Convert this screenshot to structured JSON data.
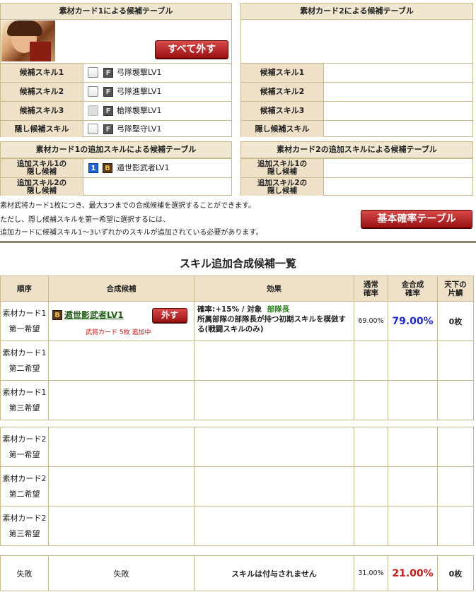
{
  "card1_table": {
    "title": "素材カード1による候補テーブル",
    "remove_all_label": "すべて外す",
    "rows": [
      {
        "label": "候補スキル1",
        "rank": "F",
        "skill": "弓隊襲撃LV1",
        "disabled": false
      },
      {
        "label": "候補スキル2",
        "rank": "F",
        "skill": "弓隊進撃LV1",
        "disabled": false
      },
      {
        "label": "候補スキル3",
        "rank": "F",
        "skill": "槍隊襲撃LV1",
        "disabled": true
      },
      {
        "label": "隠し候補スキル",
        "rank": "F",
        "skill": "弓隊堅守LV1",
        "disabled": false
      }
    ]
  },
  "card2_table": {
    "title": "素材カード2による候補テーブル",
    "rows": [
      {
        "label": "候補スキル1"
      },
      {
        "label": "候補スキル2"
      },
      {
        "label": "候補スキル3"
      },
      {
        "label": "隠し候補スキル"
      }
    ]
  },
  "card1_extra": {
    "title": "素材カード1の追加スキルによる候補テーブル",
    "rows": [
      {
        "label_a": "追加スキル1の",
        "label_b": "隠し候補",
        "num": "1",
        "rank": "B",
        "skill": "遁世影武者LV1"
      },
      {
        "label_a": "追加スキル2の",
        "label_b": "隠し候補"
      }
    ]
  },
  "card2_extra": {
    "title": "素材カード2の追加スキルによる候補テーブル",
    "rows": [
      {
        "label_a": "追加スキル1の",
        "label_b": "隠し候補"
      },
      {
        "label_a": "追加スキル2の",
        "label_b": "隠し候補"
      }
    ]
  },
  "notes": {
    "line1": "素材武将カード1枚につき、最大3つまでの合成候補を選択することができます。",
    "line2": "ただし、隠し候補スキルを第一希望に選択するには、",
    "line3": "追加カードに候補スキル1〜3いずれかのスキルが追加されている必要があります。"
  },
  "base_prob_button": "基本確率テーブル",
  "list": {
    "title": "スキル追加合成候補一覧",
    "headers": {
      "order": "順序",
      "candidate": "合成候補",
      "effect": "効果",
      "normal_a": "通常",
      "normal_b": "確率",
      "gold_a": "金合成",
      "gold_b": "確率",
      "tenka_a": "天下の",
      "tenka_b": "片鱗"
    },
    "rows": [
      {
        "order_a": "素材カード1",
        "order_b": "第一希望",
        "rank": "B",
        "skill": "遁世影武者LV1",
        "remove": "外す",
        "sub": "武将カード 5枚 追加中",
        "effect_rate": "確率:+15%  /  対象",
        "effect_target": "部隊長",
        "effect_desc": "所属部隊の部隊長が持つ初期スキルを模倣する(戦闘スキルのみ)",
        "normal": "69.00%",
        "gold": "79.00%",
        "tenka": "0枚"
      },
      {
        "order_a": "素材カード1",
        "order_b": "第二希望"
      },
      {
        "order_a": "素材カード1",
        "order_b": "第三希望"
      },
      {
        "order_a": "素材カード2",
        "order_b": "第一希望"
      },
      {
        "order_a": "素材カード2",
        "order_b": "第二希望"
      },
      {
        "order_a": "素材カード2",
        "order_b": "第三希望"
      }
    ],
    "fail_row": {
      "order": "失敗",
      "candidate": "失敗",
      "effect": "スキルは付与されません",
      "normal": "31.00%",
      "gold": "21.00%",
      "tenka": "0枚"
    }
  },
  "colors": {
    "accent_red": "#c81818",
    "gold_blue": "#1f2bd6",
    "target_green": "#2e7d1f"
  }
}
